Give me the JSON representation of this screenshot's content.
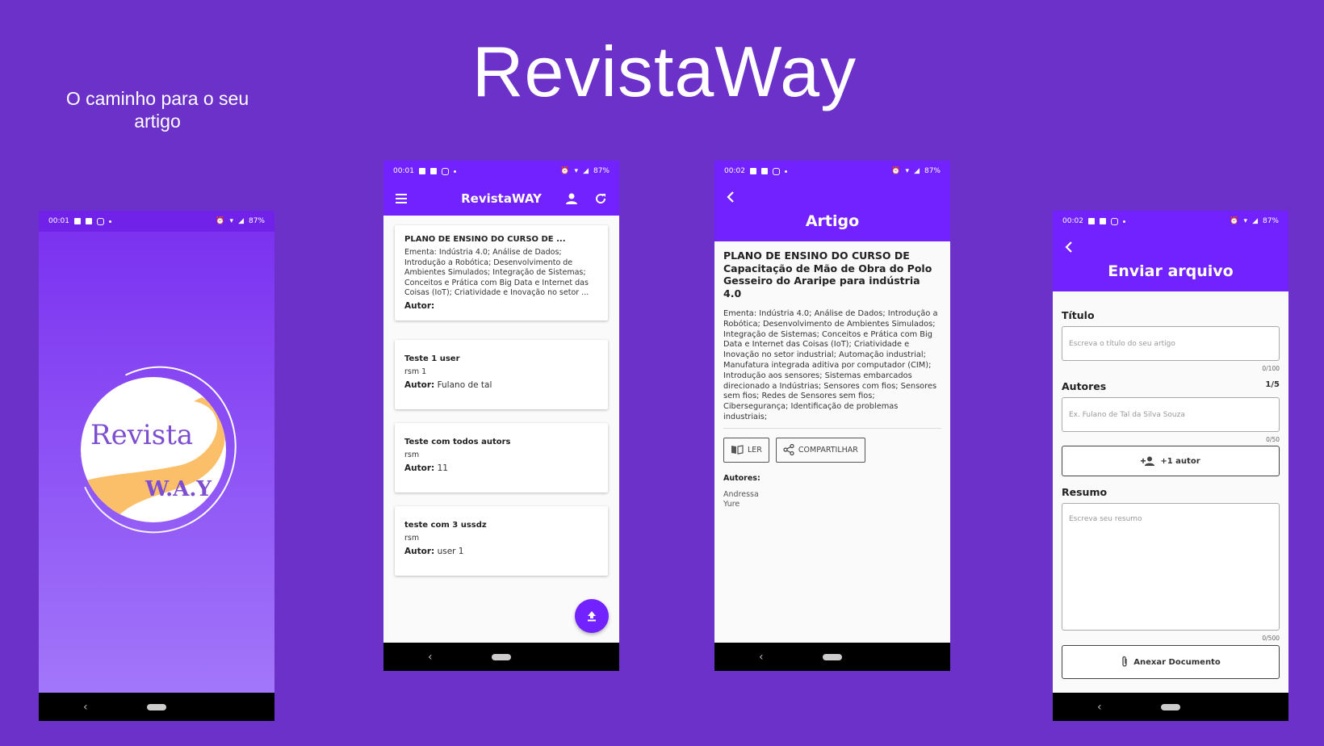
{
  "hero": {
    "title": "RevistaWay",
    "tagline": "O caminho para o seu artigo"
  },
  "splash": {
    "status": {
      "time": "00:01",
      "battery": "87%"
    },
    "logo": {
      "word1": "Revista",
      "word2": "W.A.Y"
    }
  },
  "list_screen": {
    "status": {
      "time": "00:01",
      "battery": "87%"
    },
    "title": "RevistaWAY",
    "author_label": "Autor:",
    "cards": [
      {
        "title": "PLANO DE ENSINO DO CURSO DE ...",
        "description": "Ementa: Indústria 4.0; Análise de Dados; Introdução a Robótica; Desenvolvimento de Ambientes Simulados; Integração de Sistemas; Conceitos e Prática com Big Data e Internet das Coisas (IoT); Criatividade e Inovação no setor ...",
        "author": ""
      },
      {
        "title": "Teste 1 user",
        "description": "rsm 1",
        "author": "Fulano de tal"
      },
      {
        "title": "Teste com todos autors",
        "description": "rsm",
        "author": "11"
      },
      {
        "title": "teste com 3 ussdz",
        "description": "rsm",
        "author": "user 1"
      }
    ]
  },
  "article_screen": {
    "status": {
      "time": "00:02",
      "battery": "87%"
    },
    "title": "Artigo",
    "article_title": "PLANO DE ENSINO DO CURSO DE Capacitação de Mão de Obra do Polo Gesseiro do Araripe para indústria 4.0",
    "description": "Ementa: Indústria 4.0; Análise de Dados; Introdução a Robótica; Desenvolvimento de Ambientes Simulados; Integração de Sistemas; Conceitos e Prática com Big Data e Internet das Coisas (IoT); Criatividade e Inovação no setor industrial; Automação industrial; Manufatura integrada aditiva por computador (CIM); Introdução aos sensores; Sistemas embarcados direcionado a Indústrias; Sensores com fios; Sensores sem fios; Redes de Sensores sem fios; Cibersegurança; Identificação de problemas industriais;",
    "read_label": "LER",
    "share_label": "COMPARTILHAR",
    "authors_label": "Autores:",
    "authors": [
      "Andressa",
      "Yure"
    ]
  },
  "upload_screen": {
    "status": {
      "time": "00:02",
      "battery": "87%"
    },
    "title": "Enviar arquivo",
    "title_field": {
      "label": "Título",
      "placeholder": "Escreva o título do seu artigo",
      "counter": "0/100"
    },
    "authors_field": {
      "label": "Autores",
      "count": "1/5",
      "placeholder": "Ex. Fulano de Tal da Silva Souza",
      "counter": "0/50"
    },
    "add_author_label": "+1 autor",
    "summary_field": {
      "label": "Resumo",
      "placeholder": "Escreva seu resumo",
      "counter": "0/500"
    },
    "attach_label": "Anexar Documento"
  },
  "colors": {
    "background": "#6c31c9",
    "primary": "#7122ff",
    "logo_accent": "#fbbf6a"
  }
}
